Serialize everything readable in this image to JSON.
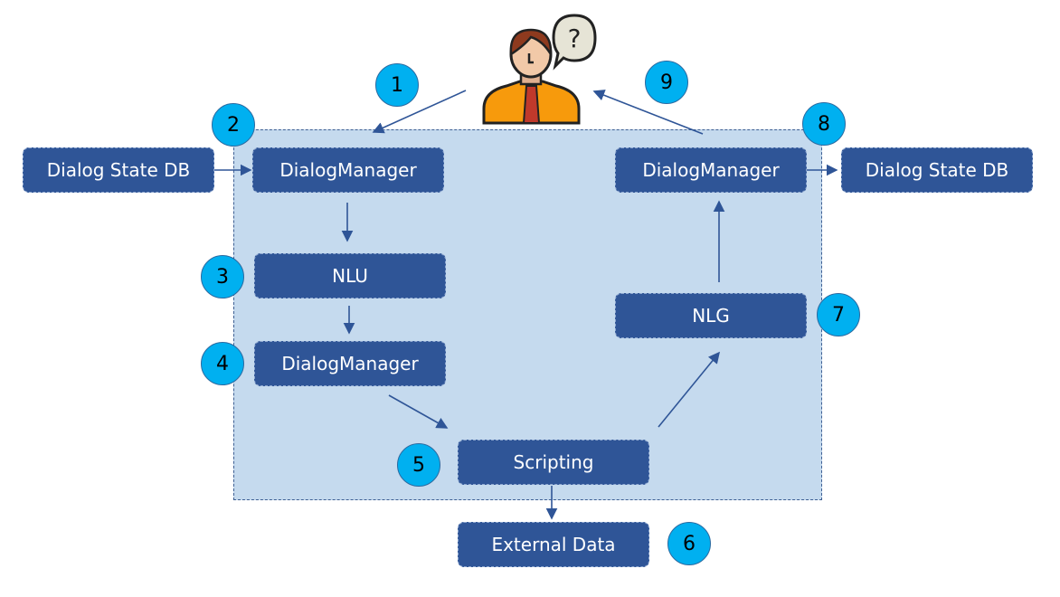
{
  "nodes": {
    "state_db_in": "Dialog State DB",
    "dm_in": "DialogManager",
    "nlu": "NLU",
    "dm_mid": "DialogManager",
    "scripting": "Scripting",
    "external": "External Data",
    "nlg": "NLG",
    "dm_out": "DialogManager",
    "state_db_out": "Dialog State DB"
  },
  "steps": [
    "1",
    "2",
    "3",
    "4",
    "5",
    "6",
    "7",
    "8",
    "9"
  ],
  "colors": {
    "box": "#2f5597",
    "panel": "#c5daee",
    "step": "#00b0f0",
    "arrow": "#2f5597"
  },
  "icons": {
    "user": "person-with-question-bubble-icon"
  }
}
